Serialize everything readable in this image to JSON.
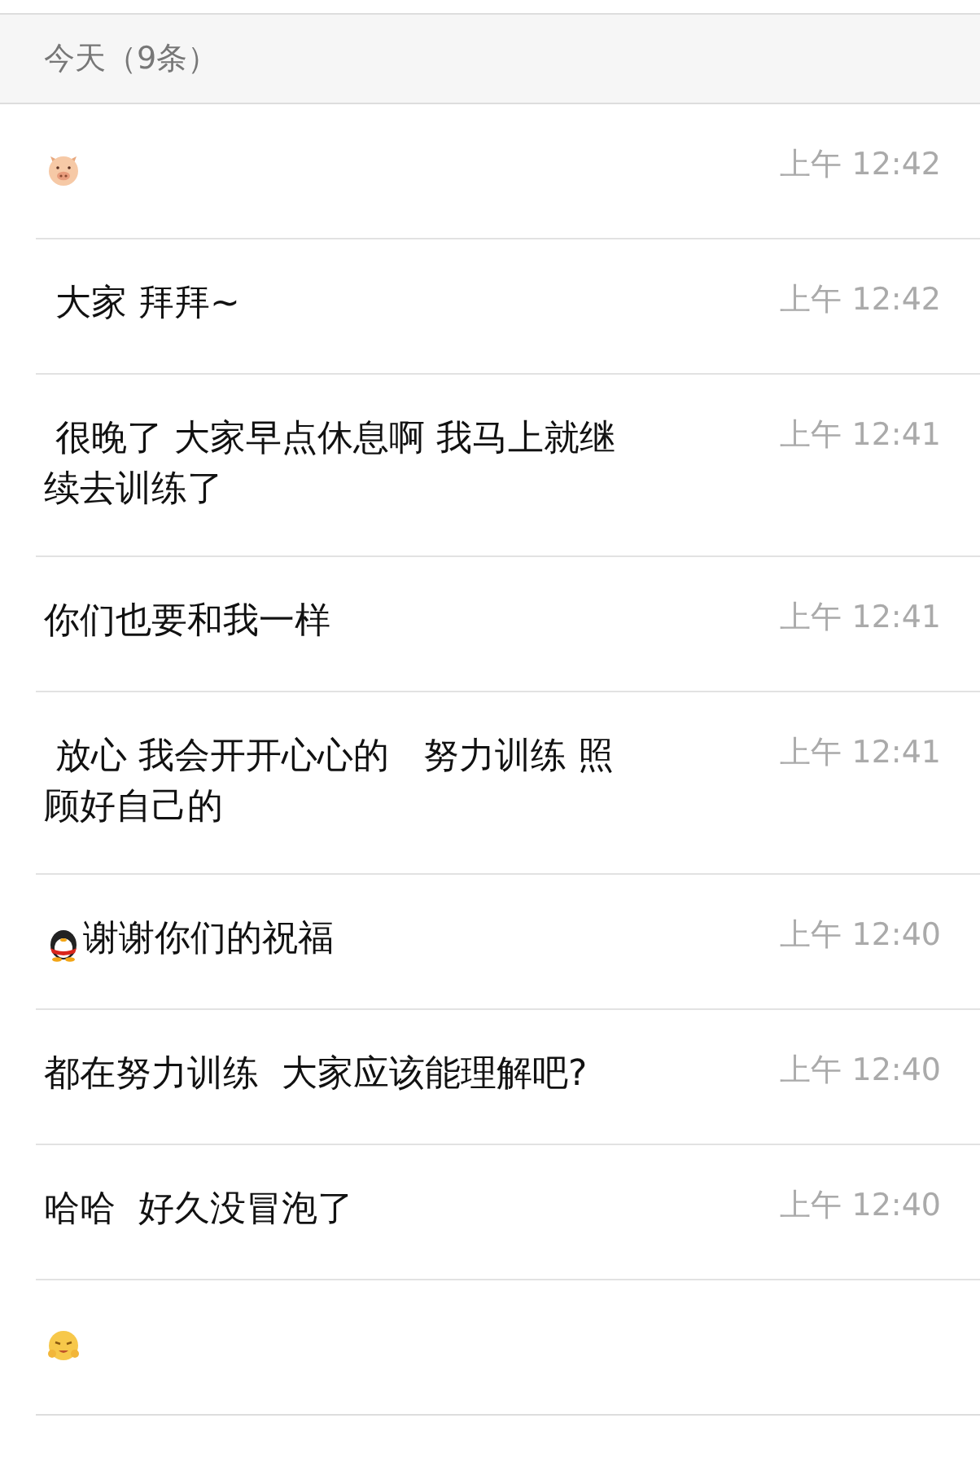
{
  "section_header": "今天（9条）",
  "messages": [
    {
      "kind": "pig",
      "time": "上午 12:42"
    },
    {
      "kind": "text",
      "text": " 大家 拜拜~",
      "time": "上午 12:42"
    },
    {
      "kind": "text",
      "text": " 很晚了 大家早点休息啊 我马上就继续去训练了",
      "time": "上午 12:41"
    },
    {
      "kind": "text",
      "text": "你们也要和我一样",
      "time": "上午 12:41"
    },
    {
      "kind": "text",
      "text": " 放心 我会开开心心的   努力训练 照顾好自己的",
      "time": "上午 12:41"
    },
    {
      "kind": "penguin",
      "text": "谢谢你们的祝福",
      "time": "上午 12:40"
    },
    {
      "kind": "text",
      "text": "都在努力训练  大家应该能理解吧?",
      "time": "上午 12:40"
    },
    {
      "kind": "text",
      "text": "哈哈  好久没冒泡了",
      "time": "上午 12:40"
    },
    {
      "kind": "laughing"
    }
  ]
}
